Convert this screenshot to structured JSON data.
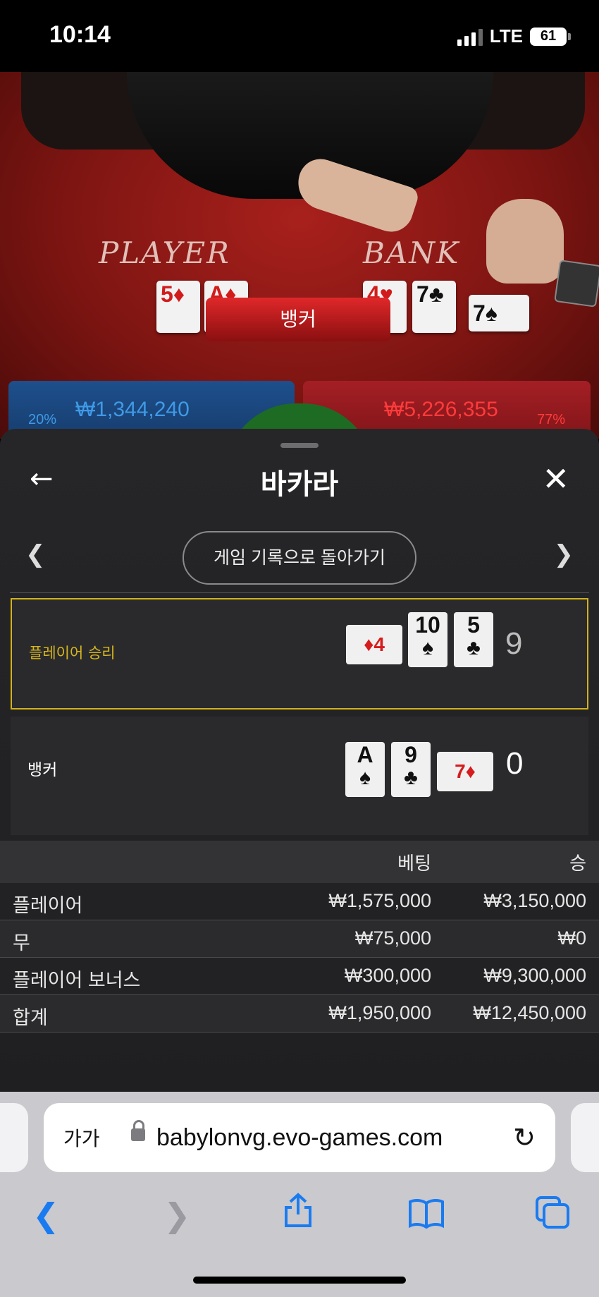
{
  "status_bar": {
    "time": "10:14",
    "network": "LTE",
    "battery": "61"
  },
  "table": {
    "player_label": "PLAYER",
    "banker_label": "BANK",
    "result_banner": "뱅커",
    "player_cards": [
      {
        "rank": "5",
        "suit": "♦",
        "color": "red"
      },
      {
        "rank": "A",
        "suit": "♦",
        "color": "red"
      }
    ],
    "banker_cards": [
      {
        "rank": "4",
        "suit": "♥",
        "color": "red"
      },
      {
        "rank": "7",
        "suit": "♣",
        "color": "black"
      },
      {
        "rank": "7",
        "suit": "♠",
        "color": "black"
      }
    ],
    "player_stat": {
      "percent": "20%",
      "amount": "₩1,344,240"
    },
    "banker_stat": {
      "percent": "77%",
      "amount": "₩5,226,355"
    }
  },
  "sheet": {
    "back_icon": "arrow-left-icon",
    "title": "바카라",
    "close_icon": "close-icon",
    "back_to_history": "게임 기록으로 돌아가기",
    "prev_icon": "chevron-left-icon",
    "next_icon": "chevron-right-icon",
    "player_row": {
      "label": "플레이어 승리",
      "score": "9",
      "cards": [
        {
          "rank": "4",
          "suit": "♦",
          "color": "red",
          "sideways": true
        },
        {
          "rank": "10",
          "suit": "♠",
          "color": "black",
          "sideways": false
        },
        {
          "rank": "5",
          "suit": "♣",
          "color": "black",
          "sideways": false
        }
      ]
    },
    "banker_row": {
      "label": "뱅커",
      "score": "0",
      "cards": [
        {
          "rank": "A",
          "suit": "♠",
          "color": "black",
          "sideways": false
        },
        {
          "rank": "9",
          "suit": "♣",
          "color": "black",
          "sideways": false
        },
        {
          "rank": "7",
          "suit": "♦",
          "color": "red",
          "sideways": true
        }
      ]
    },
    "bet_table": {
      "headers": [
        "",
        "베팅",
        "승"
      ],
      "rows": [
        [
          "플레이어",
          "₩1,575,000",
          "₩3,150,000"
        ],
        [
          "무",
          "₩75,000",
          "₩0"
        ],
        [
          "플레이어 보너스",
          "₩300,000",
          "₩9,300,000"
        ],
        [
          "합계",
          "₩1,950,000",
          "₩12,450,000"
        ]
      ]
    }
  },
  "browser": {
    "text_size_label": "가가",
    "url": "babylonvg.evo-games.com",
    "toolbar": [
      "back-icon",
      "forward-icon",
      "share-icon",
      "bookmarks-icon",
      "tabs-icon"
    ]
  },
  "colors": {
    "accent_yellow": "#d6b51e",
    "link_blue": "#1a7bf0",
    "banker_red": "#d21c1c",
    "player_blue": "#3f9ae6"
  }
}
